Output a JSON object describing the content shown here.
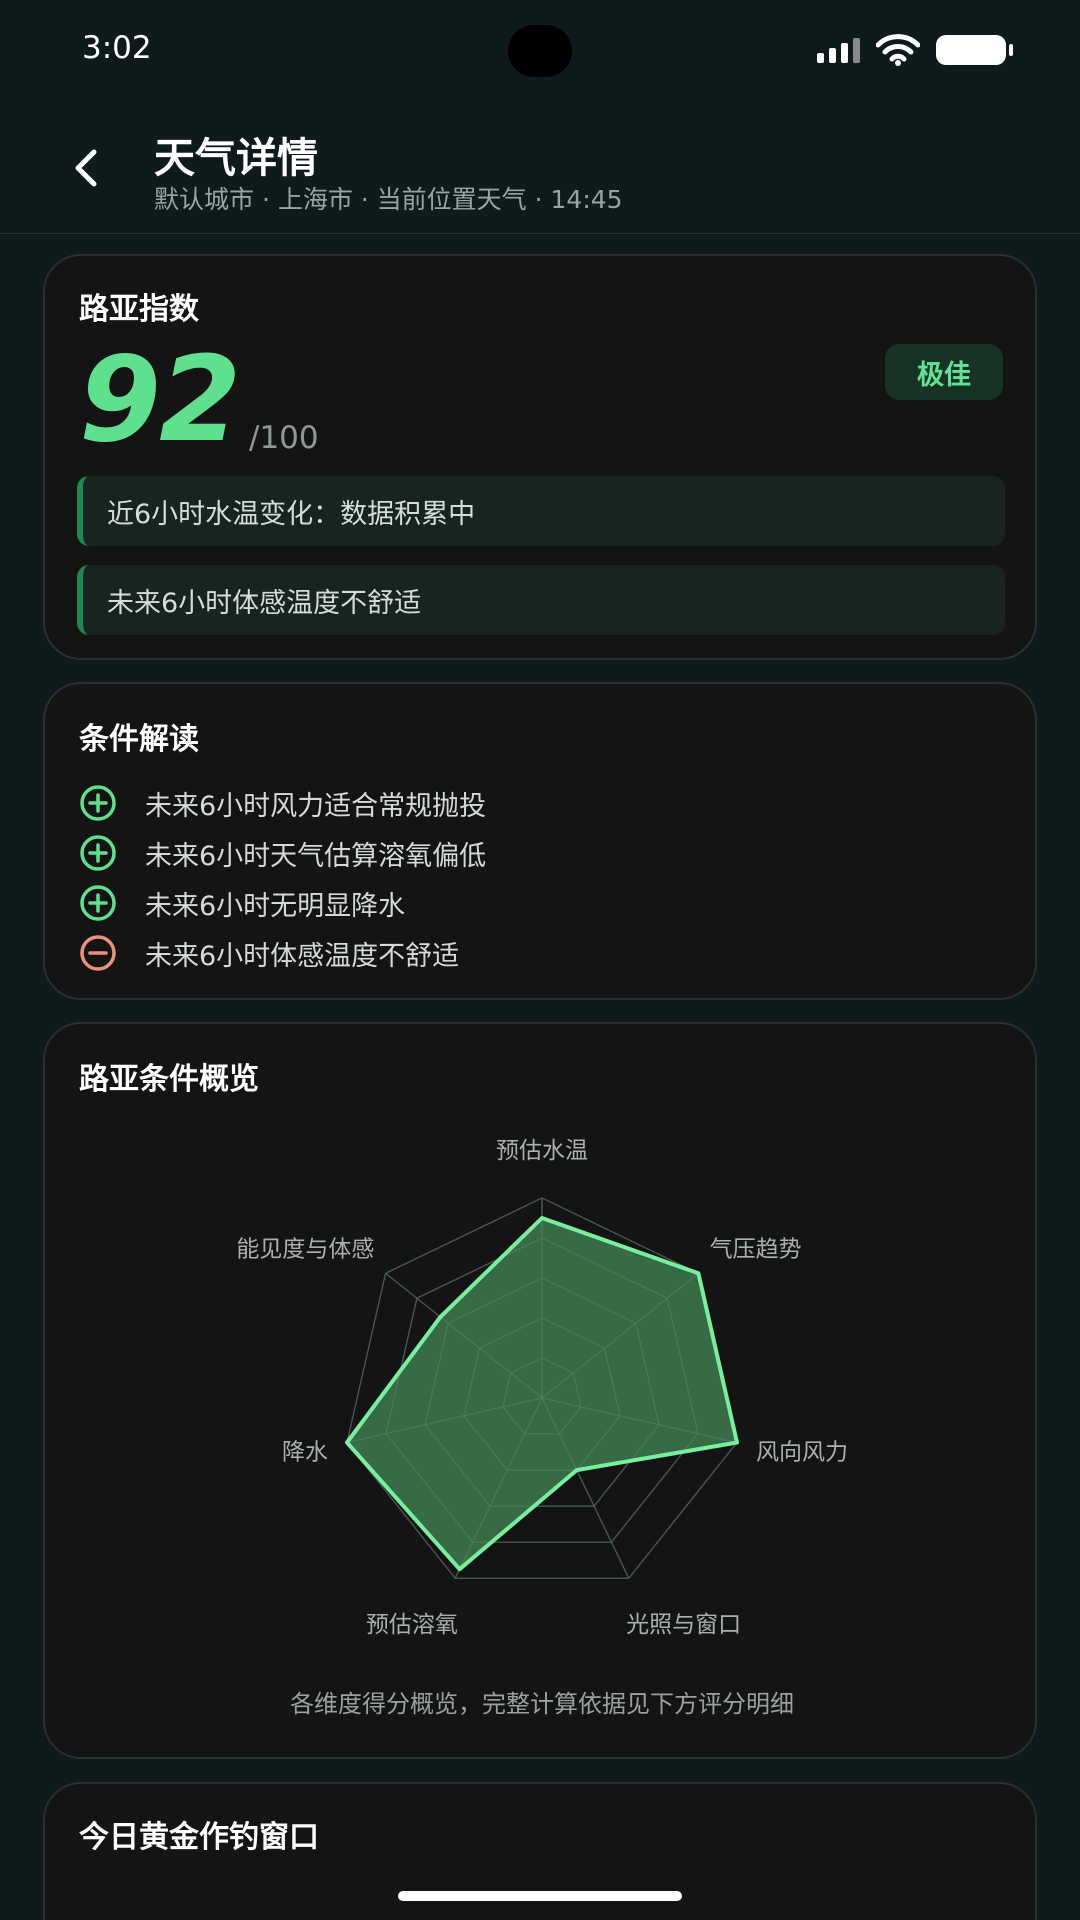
{
  "status_bar": {
    "time": "3:02"
  },
  "header": {
    "title": "天气详情",
    "subtitle": "默认城市 · 上海市 · 当前位置天气 · 14:45"
  },
  "lure_index": {
    "title": "路亚指数",
    "score": "92",
    "max": "/100",
    "grade": "极佳",
    "notes": [
      "近6小时水温变化：数据积累中",
      "未来6小时体感温度不舒适"
    ],
    "accent_color": "#5ee08e"
  },
  "conditions": {
    "title": "条件解读",
    "items": [
      {
        "type": "positive",
        "icon": "plus-circle-icon",
        "text": "未来6小时风力适合常规抛投"
      },
      {
        "type": "positive",
        "icon": "plus-circle-icon",
        "text": "未来6小时天气估算溶氧偏低"
      },
      {
        "type": "positive",
        "icon": "plus-circle-icon",
        "text": "未来6小时无明显降水"
      },
      {
        "type": "negative",
        "icon": "minus-circle-icon",
        "text": "未来6小时体感温度不舒适"
      }
    ],
    "positive_color": "#5ee08e",
    "negative_color": "#e8937a"
  },
  "overview": {
    "title": "路亚条件概览",
    "caption": "各维度得分概览，完整计算依据见下方评分明细"
  },
  "chart_data": {
    "type": "radar",
    "axes": [
      "预估水温",
      "气压趋势",
      "风向风力",
      "光照与窗口",
      "预估溶氧",
      "降水",
      "能见度与体感"
    ],
    "values": [
      90,
      100,
      100,
      40,
      95,
      100,
      65
    ],
    "range": [
      0,
      100
    ],
    "rings": 5,
    "fill_color": "#3c7a4f",
    "line_color": "#76f09e"
  },
  "golden_window": {
    "title": "今日黄金作钓窗口"
  }
}
